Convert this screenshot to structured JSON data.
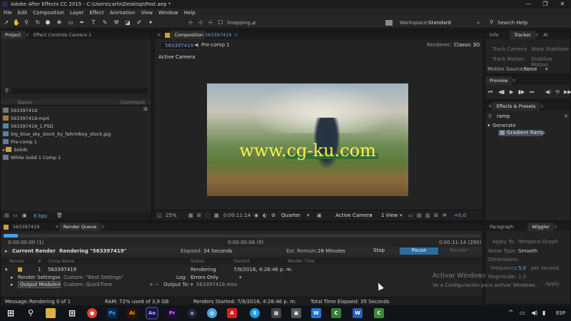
{
  "window": {
    "title": "Adobe After Effects CC 2015 - C:\\Users\\carlo\\Desktop\\Post.aep *",
    "minimize": "—",
    "maximize": "❐",
    "close": "✕"
  },
  "menu": [
    "File",
    "Edit",
    "Composition",
    "Layer",
    "Effect",
    "Animation",
    "View",
    "Window",
    "Help"
  ],
  "toolbar": {
    "snapping": "Snapping",
    "workspace_label": "Workspace:",
    "workspace_value": "Standard",
    "search_help": "Search Help"
  },
  "project": {
    "tab_project": "Project",
    "tab_effect_controls": "Effect Controls Camera 1",
    "search_placeholder": "",
    "col_name": "Name",
    "col_comment": "Comment",
    "items": [
      "563397419",
      "563397419.mp4",
      "563397419_1.PSD",
      "big_blue_sky_stock_by_fahrmboy_stock.jpg",
      "Pre-comp 1",
      "Solids",
      "White Solid 1 Comp 1"
    ],
    "bpc": "8 bpc"
  },
  "composition": {
    "tab": "Composition",
    "tab_name": "563397419",
    "breadcrumb_1": "563397419",
    "breadcrumb_2": "Pre-comp 1",
    "renderer_label": "Renderer:",
    "renderer_value": "Classic 3D",
    "active_camera": "Active Camera",
    "watermark": "www.cg-ku.com",
    "zoom": "25%",
    "timecode": "0:00:11:14",
    "resolution": "Quarter",
    "camera_view": "Active Camera",
    "views": "1 View",
    "exposure": "+0,0"
  },
  "right_panels": {
    "tab_info": "Info",
    "tab_tracker": "Tracker",
    "tab_al": "Al",
    "track_camera": "Track Camera",
    "warp_stabilizer": "Warp Stabilizer",
    "track_motion": "Track Motion",
    "stabilize_motion": "Stabilize Motion",
    "motion_source_label": "Motion Source:",
    "motion_source_value": "None",
    "preview": "Preview",
    "effects_presets": "Effects & Presets",
    "search_value": "ramp",
    "generate": "Generate",
    "gradient_ramp": "Gradient Ramp"
  },
  "bottom_tabs": {
    "comp_tab": "563397419",
    "render_queue": "Render Queue"
  },
  "render_queue": {
    "time_start": "0:00:00:00 (1)",
    "time_mid": "0:00:00:08 (9)",
    "time_end": "0:00:11:14 (290)",
    "current_render": "Current Render",
    "rendering": "Rendering \"563397419\"",
    "elapsed_label": "Elapsed:",
    "elapsed_value": "34 Seconds",
    "remain_label": "Est. Remain:",
    "remain_value": "28 Minutes",
    "stop": "Stop",
    "pause": "Pause",
    "render": "Render",
    "headers": [
      "Render",
      "#",
      "Comp Name",
      "Status",
      "Started",
      "Render Time"
    ],
    "item_num": "1",
    "item_comp": "563397419",
    "item_status": "Rendering",
    "item_started": "7/9/2016, 4:28:46 p. m.",
    "item_render_time": "-",
    "render_settings_label": "Render Settings:",
    "render_settings_value": "Custom: \"Best Settings\"",
    "output_module_label": "Output Module:",
    "output_module_value": "Custom: QuickTime",
    "log_label": "Log:",
    "log_value": "Errors Only",
    "output_to_label": "Output To:",
    "output_to_value": "563397419.mov",
    "message_label": "Message:",
    "message_value": "Rendering 0 of 1",
    "ram": "RAM: 72% used of 3,9 GB",
    "renders_started": "Renders Started: 7/9/2016, 4:28:46 p. m.",
    "total_time": "Total Time Elapsed: 35 Seconds"
  },
  "wiggler": {
    "tab_paragraph": "Paragraph",
    "tab_wiggler": "Wiggler",
    "apply_to_label": "Apply To:",
    "apply_to_value": "Temporal Graph",
    "noise_type_label": "Noise Type:",
    "noise_type_value": "Smooth",
    "dimensions_label": "Dimensions:",
    "frequency_label": "Frequency:",
    "frequency_value": "5,0",
    "frequency_unit": "per second",
    "magnitude_label": "Magnitude:",
    "magnitude_value": "1,0",
    "apply": "Apply"
  },
  "activation": {
    "title": "Activar Windows",
    "subtitle": "Ve a Configuración para activar Windows."
  },
  "taskbar": {
    "lang": "ESP"
  }
}
